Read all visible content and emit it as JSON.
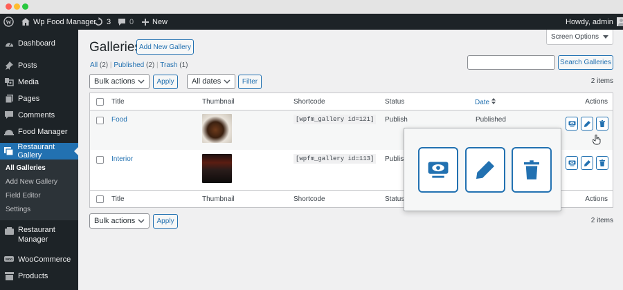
{
  "admin_bar": {
    "site_name": "Wp Food Manager",
    "updates_count": "3",
    "comments_count": "0",
    "new_label": "New",
    "howdy": "Howdy, admin"
  },
  "sidebar": {
    "items": [
      {
        "label": "Dashboard",
        "icon": "dashboard-icon"
      },
      {
        "label": "Posts",
        "icon": "pin-icon"
      },
      {
        "label": "Media",
        "icon": "media-icon"
      },
      {
        "label": "Pages",
        "icon": "pages-icon"
      },
      {
        "label": "Comments",
        "icon": "comment-icon"
      },
      {
        "label": "Food Manager",
        "icon": "food-icon"
      },
      {
        "label": "Restaurant Gallery",
        "icon": "gallery-icon"
      },
      {
        "label": "Restaurant Manager",
        "icon": "restaurant-icon"
      },
      {
        "label": "WooCommerce",
        "icon": "woo-icon"
      },
      {
        "label": "Products",
        "icon": "products-icon"
      }
    ],
    "restaurant_manager_line1": "Restaurant",
    "restaurant_manager_line2": "Manager",
    "submenu": [
      "All Galleries",
      "Add New Gallery",
      "Field Editor",
      "Settings"
    ]
  },
  "page": {
    "title": "Galleries",
    "add_new": "Add New Gallery",
    "screen_options": "Screen Options",
    "filters": {
      "all": "All",
      "all_count": "(2)",
      "published": "Published",
      "published_count": "(2)",
      "trash": "Trash",
      "trash_count": "(1)",
      "sep": "|"
    },
    "search_placeholder": "",
    "search_button": "Search Galleries",
    "bulk_actions": "Bulk actions",
    "apply": "Apply",
    "all_dates": "All dates",
    "filter": "Filter",
    "items_count": "2 items"
  },
  "table": {
    "columns": {
      "title": "Title",
      "thumbnail": "Thumbnail",
      "shortcode": "Shortcode",
      "status": "Status",
      "date": "Date",
      "actions": "Actions"
    },
    "rows": [
      {
        "title": "Food",
        "shortcode": "[wpfm_gallery id=121]",
        "status": "Publish",
        "date_status": "Published"
      },
      {
        "title": "Interior",
        "shortcode": "[wpfm_gallery id=113]",
        "status": "Publish",
        "date_status": ""
      }
    ]
  },
  "colors": {
    "accent": "#2271b1",
    "sidebar": "#1d2327",
    "active": "#2271b1"
  }
}
